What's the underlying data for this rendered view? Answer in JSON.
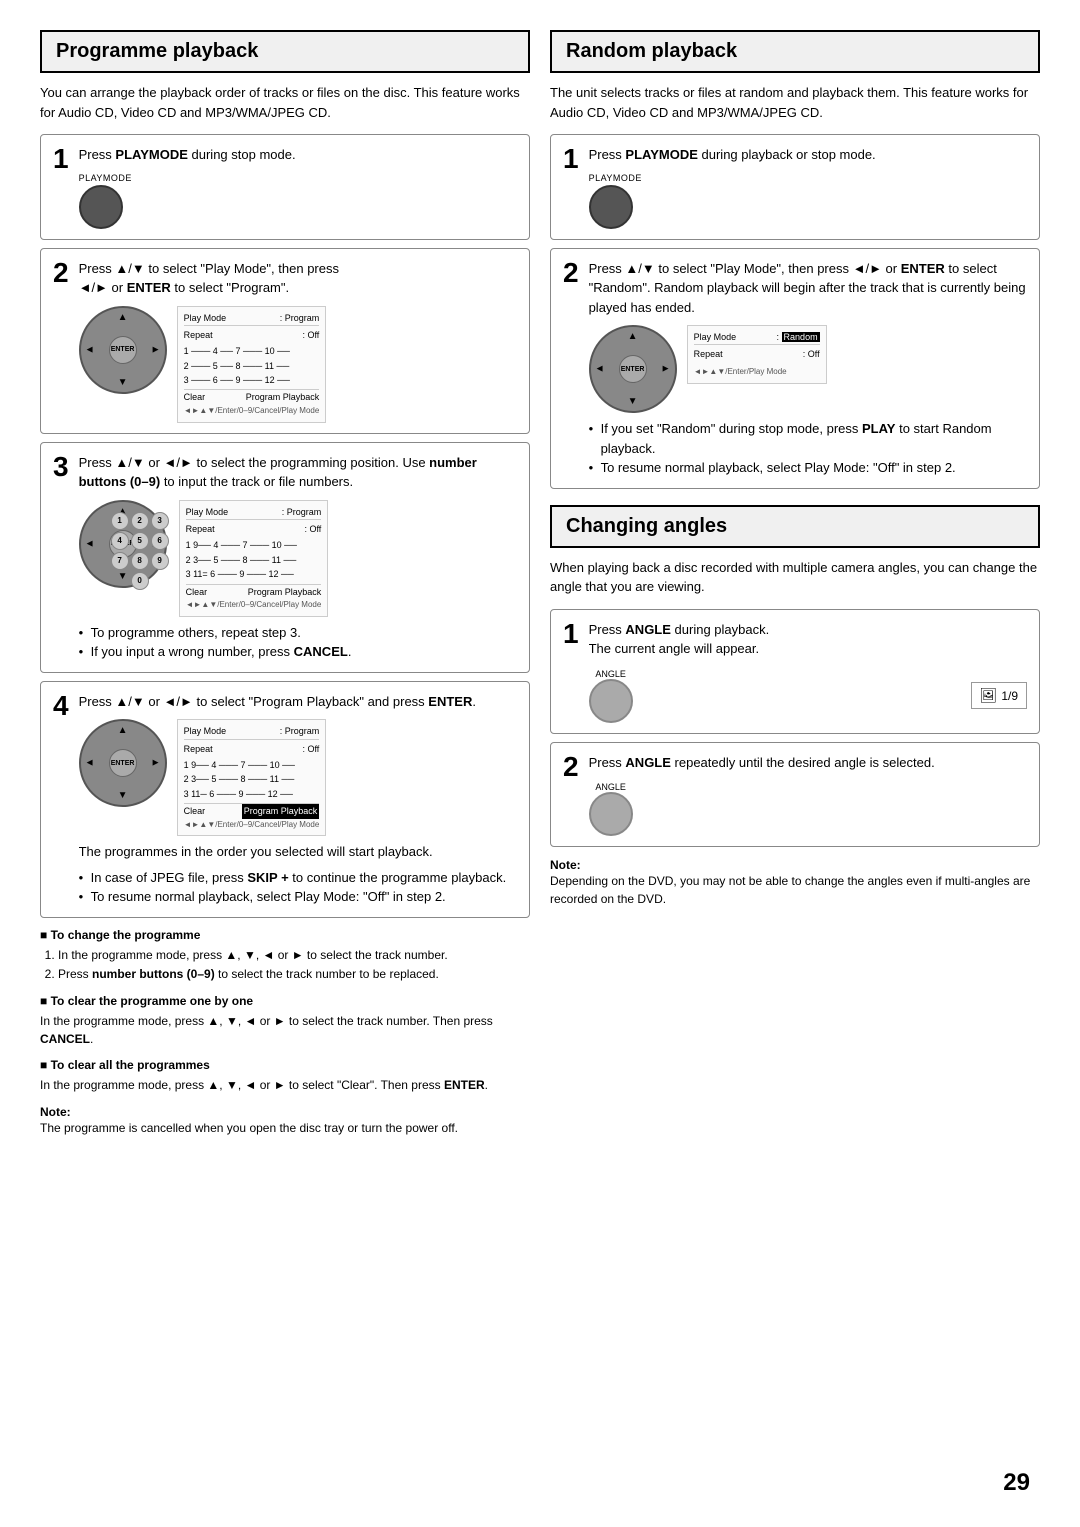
{
  "left": {
    "title": "Programme playback",
    "intro": "You can arrange the playback order of tracks or files on the disc. This feature works for Audio CD, Video CD and MP3/WMA/JPEG CD.",
    "steps": [
      {
        "num": "1",
        "text": "Press PLAYMODE during stop mode.",
        "bold_words": [
          "PLAYMODE"
        ],
        "show_playmode": true,
        "show_dpad": false,
        "show_table": false,
        "show_numpad": false
      },
      {
        "num": "2",
        "text": "Press ▲/▼ to select \"Play Mode\", then press ◄/► or ENTER to select \"Program\".",
        "bold_words": [
          "ENTER"
        ],
        "show_playmode": false,
        "show_dpad": true,
        "show_table": true,
        "table_highlight": "",
        "table_data": {
          "mode": "Program",
          "repeat": "Off",
          "rows": [
            "1 ─── 4 ──  7 ───  10 ──",
            "2 ─── 5 ──  8 ───  11 ──",
            "3 ─── 6 ──  9 ───  12 ──"
          ],
          "footer": "Clear        Program Playback",
          "nav": "◄►▲▼/Enter/0–9/Cancel/Play Mode"
        }
      },
      {
        "num": "3",
        "text": "Press ▲/▼ or ◄/► to select the programming position. Use number buttons (0–9) to input the track or file numbers.",
        "bold_words": [
          "number buttons (0–9)"
        ],
        "show_playmode": false,
        "show_dpad": true,
        "show_numpad": true,
        "show_table": true,
        "table_data": {
          "mode": "Program",
          "repeat": "Off",
          "rows": [
            "1 9── 4 ─── 7 ───  10 ──",
            "2 3── 5 ─── 8 ───  11 ──",
            "3 11= 6 ─── 9 ───  12 ──"
          ],
          "footer": "Clear        Program Playback",
          "nav": "◄►▲▼/Enter/0–9/Cancel/Play Mode"
        },
        "bullets": [
          "To programme others, repeat step 3.",
          "If you input a wrong number, press CANCEL."
        ]
      },
      {
        "num": "4",
        "text": "Press ▲/▼ or ◄/► to select \"Program Playback\" and press ENTER.",
        "bold_words": [
          "ENTER"
        ],
        "show_playmode": false,
        "show_dpad": true,
        "show_table": true,
        "table_data": {
          "mode": "Program",
          "repeat": "Off",
          "rows": [
            "1 9── 4 ─── 7 ───  10 ──",
            "2 3── 5 ─── 8 ───  11 ──",
            "3 11─ 6 ─── 9 ───  12 ──"
          ],
          "footer_highlighted": "Program Playback",
          "footer_left": "Clear",
          "nav": "◄►▲▼/Enter/0–9/Cancel/Play Mode"
        },
        "para": "The programmes in the order you selected will start playback.",
        "bullets": [
          "In case of JPEG file, press SKIP + to continue the programme playback.",
          "To resume normal playback, select Play Mode: \"Off\" in step 2."
        ]
      }
    ],
    "sub_sections": [
      {
        "title": "To change the programme",
        "items": [
          "In the programme mode, press ▲, ▼, ◄ or ► to select the track number.",
          "Press number buttons (0–9) to select the track number to be replaced."
        ]
      },
      {
        "title": "To clear the programme one by one",
        "text": "In the programme mode, press ▲, ▼, ◄ or ► to select the track number. Then press CANCEL."
      },
      {
        "title": "To clear all the programmes",
        "text": "In the programme mode, press ▲, ▼, ◄ or ► to select \"Clear\". Then press ENTER."
      }
    ],
    "note": {
      "label": "Note:",
      "text": "The programme is cancelled when you open the disc tray or turn the power off."
    }
  },
  "right": {
    "title": "Random playback",
    "intro": "The unit selects tracks or files at random and playback them. This feature works for Audio CD, Video CD and MP3/WMA/JPEG CD.",
    "steps": [
      {
        "num": "1",
        "text": "Press PLAYMODE during playback or stop mode.",
        "bold_words": [
          "PLAYMODE"
        ],
        "show_playmode": true
      },
      {
        "num": "2",
        "text": "Press ▲/▼ to select \"Play Mode\", then press ◄/► or ENTER to select \"Random\". Random playback will begin after the track that is currently being played has ended.",
        "bold_words": [
          "ENTER"
        ],
        "show_dpad": true,
        "show_table": true,
        "table_data": {
          "mode_highlighted": "Random",
          "repeat": "Off",
          "nav": "◄►▲▼/Enter/Play Mode"
        },
        "bullets": [
          "If you set \"Random\" during stop mode, press PLAY to start Random playback.",
          "To resume normal playback, select Play Mode: \"Off\" in step 2."
        ]
      }
    ],
    "changing_angles": {
      "title": "Changing angles",
      "intro": "When playing back a disc recorded with multiple camera angles, you can change the angle that you are viewing.",
      "steps": [
        {
          "num": "1",
          "text": "Press ANGLE during playback. The current angle will appear.",
          "bold_words": [
            "ANGLE"
          ],
          "show_angle_btn": true,
          "show_angle_display": true,
          "angle_display": "🖼 1/9"
        },
        {
          "num": "2",
          "text": "Press ANGLE repeatedly until the desired angle is selected.",
          "bold_words": [
            "ANGLE"
          ],
          "show_angle_btn": true
        }
      ],
      "note": {
        "label": "Note:",
        "text": "Depending on the DVD, you may not be able to change the angles even if multi-angles are recorded on the DVD."
      }
    }
  },
  "page_number": "29"
}
